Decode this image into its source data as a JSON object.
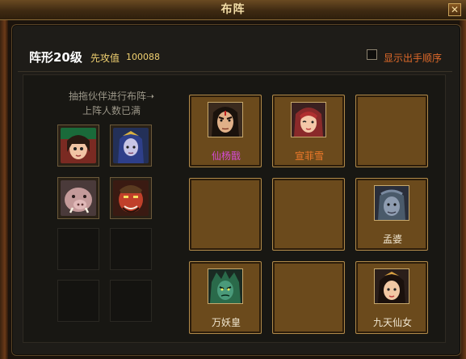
{
  "window": {
    "title": "布阵",
    "close_symbol": "✕"
  },
  "header": {
    "formation": "阵形20级",
    "attack_label": "先攻值",
    "attack_value": "100088",
    "show_order_label": "显示出手顺序"
  },
  "bench": {
    "hint_line1": "抽拖伙伴进行布阵➝",
    "hint_line2": "上阵人数已满",
    "portraits": [
      {
        "icon": "girl-red-hair-portrait",
        "color": "#a23a2a"
      },
      {
        "icon": "blue-hair-warrior-portrait",
        "color": "#3b4a8a"
      },
      {
        "icon": "boar-beast-portrait",
        "color": "#6e5a5a"
      },
      {
        "icon": "red-demon-general-portrait",
        "color": "#8a2a1a"
      }
    ]
  },
  "grid": {
    "slots": [
      {
        "name": "仙杨戬",
        "name_color": "purple",
        "icon": "yang-jian-portrait"
      },
      {
        "name": "宣菲雪",
        "name_color": "orange",
        "icon": "xuan-feixue-portrait"
      },
      {
        "name": "",
        "name_color": "",
        "icon": ""
      },
      {
        "name": "",
        "name_color": "",
        "icon": ""
      },
      {
        "name": "",
        "name_color": "",
        "icon": ""
      },
      {
        "name": "孟婆",
        "name_color": "white",
        "icon": "meng-po-portrait"
      },
      {
        "name": "万妖皇",
        "name_color": "white",
        "icon": "wan-yao-huang-portrait"
      },
      {
        "name": "",
        "name_color": "",
        "icon": ""
      },
      {
        "name": "九天仙女",
        "name_color": "white",
        "icon": "jiu-tian-xian-nv-portrait"
      }
    ]
  }
}
